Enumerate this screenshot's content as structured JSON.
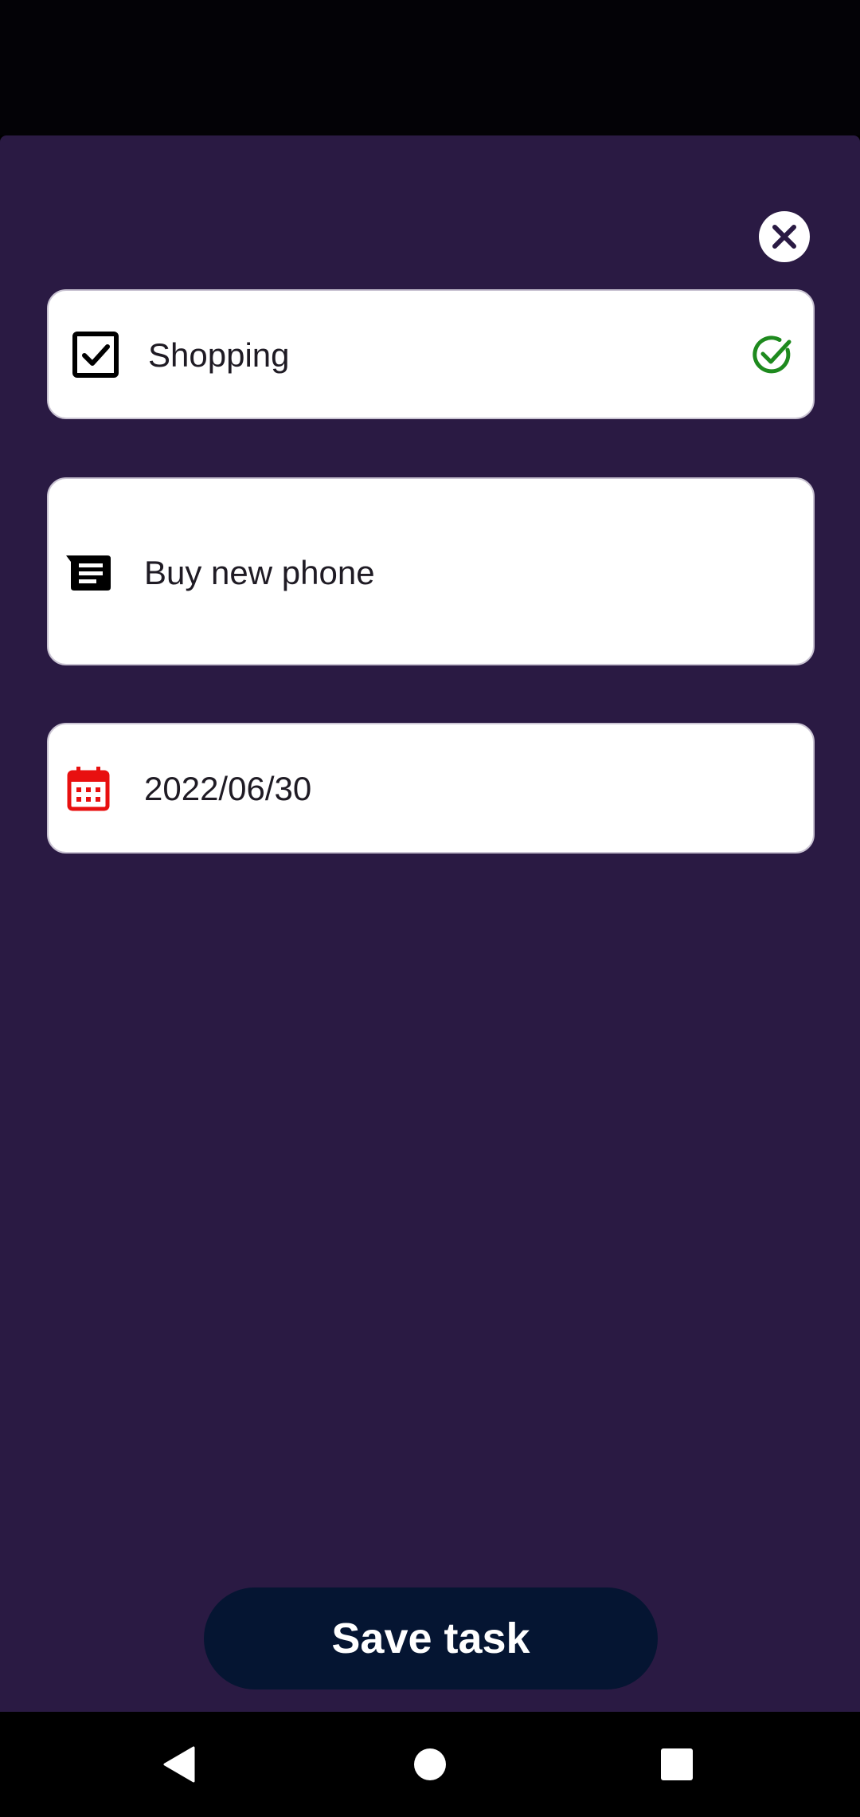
{
  "form": {
    "category_value": "Shopping",
    "title_value": "Buy new phone",
    "date_value": "2022/06/30"
  },
  "actions": {
    "save_label": "Save task"
  },
  "icons": {
    "close": "close-icon",
    "category": "checkbox-icon",
    "confirm": "check-circle-icon",
    "title": "notes-icon",
    "date": "calendar-icon",
    "nav_back": "back-triangle-icon",
    "nav_home": "home-circle-icon",
    "nav_recents": "recents-square-icon"
  },
  "colors": {
    "background": "#2a1a43",
    "save_button": "#051532",
    "confirm_green": "#1e8a1e",
    "calendar_red": "#e81010"
  }
}
